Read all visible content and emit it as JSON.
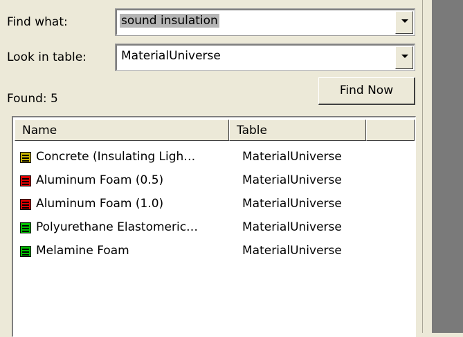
{
  "find_what": {
    "label": "Find what:",
    "value": "sound insulation"
  },
  "look_in_table": {
    "label": "Look in table:",
    "value": "MaterialUniverse"
  },
  "found_label": "Found: 5",
  "find_now_label": "Find Now",
  "results": {
    "columns": [
      "Name",
      "Table",
      ""
    ],
    "rows": [
      {
        "name": "Concrete (Insulating Ligh…",
        "table": "MaterialUniverse",
        "icon": "material-sheet-icon",
        "color": "#c8b400"
      },
      {
        "name": "Aluminum Foam (0.5)",
        "table": "MaterialUniverse",
        "icon": "material-sheet-icon",
        "color": "#e00000"
      },
      {
        "name": "Aluminum Foam (1.0)",
        "table": "MaterialUniverse",
        "icon": "material-sheet-icon",
        "color": "#e00000"
      },
      {
        "name": "Polyurethane Elastomeric…",
        "table": "MaterialUniverse",
        "icon": "material-sheet-icon",
        "color": "#00c000"
      },
      {
        "name": "Melamine Foam",
        "table": "MaterialUniverse",
        "icon": "material-sheet-icon",
        "color": "#00c000"
      }
    ]
  }
}
